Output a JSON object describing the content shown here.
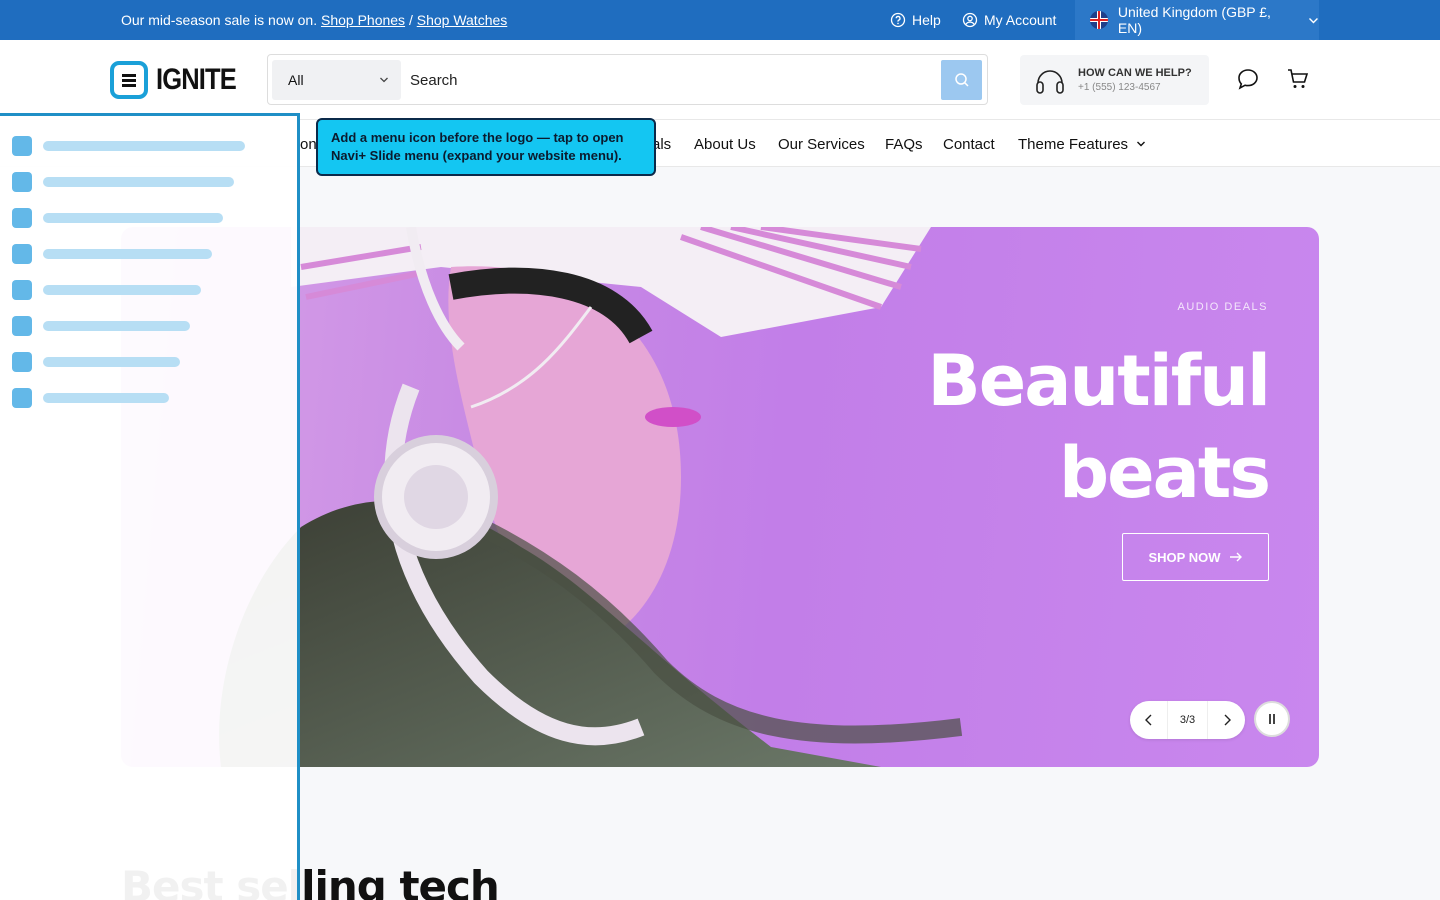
{
  "topbar": {
    "announce_text": "Our mid-season sale is now on.",
    "link_phones": "Shop Phones",
    "separator": "/",
    "link_watches": "Shop Watches",
    "help": "Help",
    "account": "My Account",
    "region": "United Kingdom (GBP £, EN)"
  },
  "header": {
    "logo_text": "IGNITE",
    "search_category": "All",
    "search_placeholder": "Search",
    "help_title": "HOW CAN WE HELP?",
    "help_phone": "+1 (555) 123-4567"
  },
  "nav": {
    "items": [
      {
        "label": "on"
      },
      {
        "label": "als"
      },
      {
        "label": "About Us"
      },
      {
        "label": "Our Services"
      },
      {
        "label": "FAQs"
      },
      {
        "label": "Contact"
      },
      {
        "label": "Theme Features"
      }
    ]
  },
  "tooltip": {
    "text": "Add a menu icon before the logo — tap to open Navi+ Slide menu (expand your website menu)."
  },
  "hero": {
    "kicker": "AUDIO DEALS",
    "headline_line1": "Beautiful",
    "headline_line2": "beats",
    "cta": "SHOP NOW",
    "pager": "3/3"
  },
  "section": {
    "heading": "Best selling tech"
  },
  "colors": {
    "topbar_bg": "#1f6dbf",
    "accent": "#1aa0d8",
    "hero_bg": "#c27ee8",
    "tooltip_bg": "#14c6f2"
  }
}
